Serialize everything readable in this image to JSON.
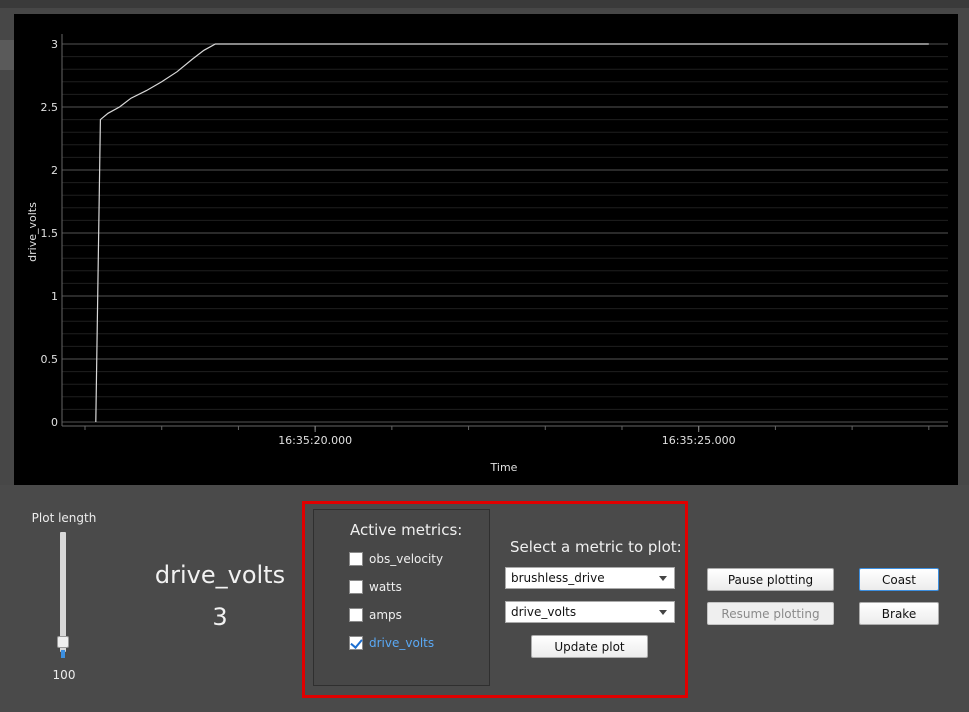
{
  "chart_data": {
    "type": "line",
    "title": "",
    "xlabel": "Time",
    "ylabel": "drive_volts",
    "ylim": [
      0,
      3
    ],
    "y_ticks": [
      "0",
      "0.5",
      "1",
      "1.5",
      "2",
      "2.5",
      "3"
    ],
    "x_tick_labels": [
      "16:35:20.000",
      "16:35:25.000"
    ],
    "x_tick_values": [
      20.0,
      25.0
    ],
    "xlim": [
      16.7,
      28.25
    ],
    "grid": true,
    "series": [
      {
        "name": "",
        "color": "#d8d8d8",
        "x": [
          17.14,
          17.2,
          17.3,
          17.45,
          17.6,
          17.8,
          18.0,
          18.2,
          18.4,
          18.55,
          18.7,
          28.0
        ],
        "y": [
          0,
          2.4,
          2.45,
          2.5,
          2.57,
          2.63,
          2.7,
          2.78,
          2.88,
          2.95,
          3.0,
          3.0
        ]
      }
    ]
  },
  "controls": {
    "plot_length_label": "Plot length",
    "plot_length_value": "100",
    "plot_length_fraction": 0.05
  },
  "current_metric": {
    "name": "drive_volts",
    "value": "3"
  },
  "active_metrics": {
    "title": "Active metrics:",
    "items": [
      {
        "label": "obs_velocity",
        "checked": false
      },
      {
        "label": "watts",
        "checked": false
      },
      {
        "label": "amps",
        "checked": false
      },
      {
        "label": "drive_volts",
        "checked": true
      }
    ]
  },
  "metric_selector": {
    "title": "Select a metric to plot:",
    "source_value": "brushless_drive",
    "metric_value": "drive_volts",
    "update_label": "Update plot"
  },
  "buttons": {
    "pause": "Pause plotting",
    "resume": "Resume plotting",
    "coast": "Coast",
    "brake": "Brake"
  },
  "colors": {
    "highlight": "#e00000",
    "accent": "#3c8fe0",
    "active_text": "#5aa9f5"
  }
}
